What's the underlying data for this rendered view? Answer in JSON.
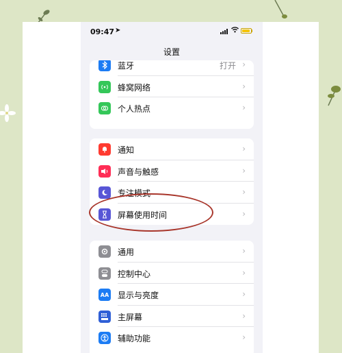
{
  "status_bar": {
    "time": "09:47"
  },
  "nav": {
    "title": "设置"
  },
  "groups": [
    {
      "items": [
        {
          "label": "蓝牙",
          "value": "打开",
          "icon": "bluetooth-icon",
          "color": "#1c7cf4"
        },
        {
          "label": "蜂窝网络",
          "icon": "cellular-icon",
          "color": "#34c759"
        },
        {
          "label": "个人热点",
          "icon": "hotspot-icon",
          "color": "#34c759"
        }
      ]
    },
    {
      "items": [
        {
          "label": "通知",
          "icon": "notification-icon",
          "color": "#ff3b30"
        },
        {
          "label": "声音与触感",
          "icon": "sound-icon",
          "color": "#ff2d55"
        },
        {
          "label": "专注模式",
          "icon": "focus-icon",
          "color": "#5856d6"
        },
        {
          "label": "屏幕使用时间",
          "icon": "screen-time-icon",
          "color": "#5856d6"
        }
      ]
    },
    {
      "items": [
        {
          "label": "通用",
          "icon": "gear-icon",
          "color": "#8e8e93"
        },
        {
          "label": "控制中心",
          "icon": "control-center-icon",
          "color": "#8e8e93"
        },
        {
          "label": "显示与亮度",
          "icon": "display-icon",
          "color": "#1c7cf4"
        },
        {
          "label": "主屏幕",
          "icon": "home-screen-icon",
          "color": "#2f5fd6"
        },
        {
          "label": "辅助功能",
          "icon": "accessibility-icon",
          "color": "#1c7cf4"
        }
      ]
    }
  ]
}
